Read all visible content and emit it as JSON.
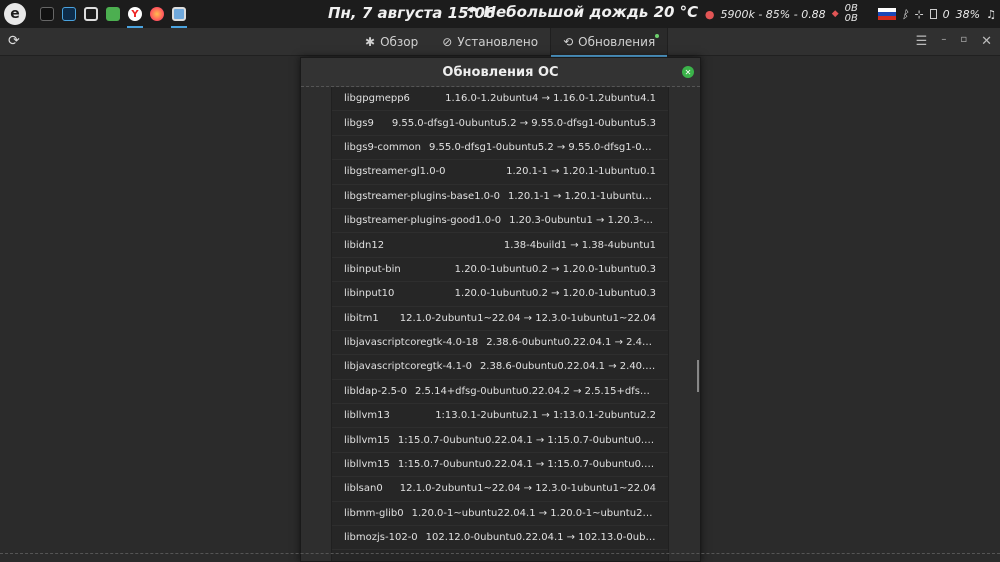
{
  "panel": {
    "clock": "Пн, 7 августа 15:06",
    "weather": "Небольшой дождь 20 °C",
    "stats": "5900k - 85% - 0.88",
    "net_up": "0B",
    "net_down": "0B",
    "notif_count": "0",
    "battery": "38%"
  },
  "tabs": [
    {
      "label": "Обзор",
      "icon": "star-icon"
    },
    {
      "label": "Установлено",
      "icon": "check-circle-icon"
    },
    {
      "label": "Обновления",
      "icon": "sync-icon"
    }
  ],
  "dialog": {
    "title": "Обновления ОС",
    "packages": [
      {
        "name": "libgpgmepp6",
        "version": "1.16.0-1.2ubuntu4 → 1.16.0-1.2ubuntu4.1"
      },
      {
        "name": "libgs9",
        "version": "9.55.0-dfsg1-0ubuntu5.2 → 9.55.0-dfsg1-0ubuntu5.3"
      },
      {
        "name": "libgs9-common",
        "version": "9.55.0-dfsg1-0ubuntu5.2 → 9.55.0-dfsg1-0ubunt..."
      },
      {
        "name": "libgstreamer-gl1.0-0",
        "version": "1.20.1-1 → 1.20.1-1ubuntu0.1"
      },
      {
        "name": "libgstreamer-plugins-base1.0-0",
        "version": "1.20.1-1 → 1.20.1-1ubuntu0.1"
      },
      {
        "name": "libgstreamer-plugins-good1.0-0",
        "version": "1.20.3-0ubuntu1 → 1.20.3-0ubunt..."
      },
      {
        "name": "libidn12",
        "version": "1.38-4build1 → 1.38-4ubuntu1"
      },
      {
        "name": "libinput-bin",
        "version": "1.20.0-1ubuntu0.2 → 1.20.0-1ubuntu0.3"
      },
      {
        "name": "libinput10",
        "version": "1.20.0-1ubuntu0.2 → 1.20.0-1ubuntu0.3"
      },
      {
        "name": "libitm1",
        "version": "12.1.0-2ubuntu1~22.04 → 12.3.0-1ubuntu1~22.04"
      },
      {
        "name": "libjavascriptcoregtk-4.0-18",
        "version": "2.38.6-0ubuntu0.22.04.1 → 2.40.4-0u..."
      },
      {
        "name": "libjavascriptcoregtk-4.1-0",
        "version": "2.38.6-0ubuntu0.22.04.1 → 2.40.4-0ub..."
      },
      {
        "name": "libldap-2.5-0",
        "version": "2.5.14+dfsg-0ubuntu0.22.04.2 → 2.5.15+dfsg-0ubu..."
      },
      {
        "name": "libllvm13",
        "version": "1:13.0.1-2ubuntu2.1 → 1:13.0.1-2ubuntu2.2"
      },
      {
        "name": "libllvm15",
        "version": "1:15.0.7-0ubuntu0.22.04.1 → 1:15.0.7-0ubuntu0.22.04.3"
      },
      {
        "name": "libllvm15",
        "version": "1:15.0.7-0ubuntu0.22.04.1 → 1:15.0.7-0ubuntu0.22.04.3"
      },
      {
        "name": "liblsan0",
        "version": "12.1.0-2ubuntu1~22.04 → 12.3.0-1ubuntu1~22.04"
      },
      {
        "name": "libmm-glib0",
        "version": "1.20.0-1~ubuntu22.04.1 → 1.20.0-1~ubuntu22.04.2"
      },
      {
        "name": "libmozjs-102-0",
        "version": "102.12.0-0ubuntu0.22.04.1 → 102.13.0-0ubuntu0...."
      }
    ]
  },
  "colors": {
    "accent": "#5ab0e8",
    "close": "#3bb34a"
  }
}
